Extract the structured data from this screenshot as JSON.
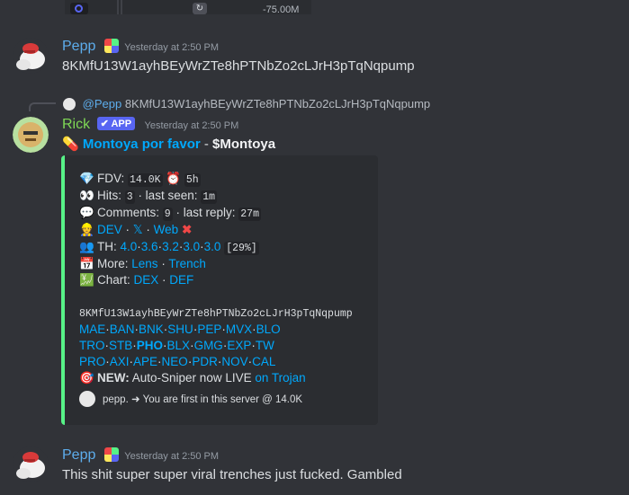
{
  "top_strip": {
    "value": "-75.00M"
  },
  "messages": [
    {
      "username": "Pepp",
      "timestamp": "Yesterday at 2:50 PM",
      "text": "8KMfU13W1ayhBEyWrZTe8hPTNbZo2cLJrH3pTqNqpump",
      "username_color": "#5dadec"
    },
    {
      "username": "Rick",
      "tag": "APP",
      "timestamp": "Yesterday at 2:50 PM",
      "username_color": "#7fd855",
      "reply": {
        "username": "@Pepp",
        "text": "8KMfU13W1ayhBEyWrZTe8hPTNbZo2cLJrH3pTqNqpump"
      },
      "headline": {
        "emoji": "pill",
        "title": "Montoya por favor",
        "sep": " - ",
        "ticker": "$Montoya"
      }
    },
    {
      "username": "Pepp",
      "timestamp": "Yesterday at 2:50 PM",
      "text": "This shit super super viral trenches just fucked. Gambled",
      "username_color": "#5dadec"
    }
  ],
  "embed": {
    "accent": "#57f287",
    "fdv_label": "FDV:",
    "fdv_value": "14.0K",
    "age_value": "5h",
    "hits_label": "Hits:",
    "hits_value": "3",
    "last_seen_label": "· last seen:",
    "last_seen_value": "1m",
    "comments_label": "Comments:",
    "comments_value": "9",
    "last_reply_label": "· last reply:",
    "last_reply_value": "27m",
    "dev_link": "DEV",
    "x_link": "𝕏",
    "web_link": "Web",
    "th_label": "TH:",
    "th_values": [
      "4.0",
      "3.6",
      "3.2",
      "3.0",
      "3.0"
    ],
    "th_total": "[29%]",
    "more_label": "More:",
    "more_links": [
      "Lens",
      "Trench"
    ],
    "chart_label": "Chart:",
    "chart_links": [
      "DEX",
      "DEF"
    ],
    "address": "8KMfU13W1ayhBEyWrZTe8hPTNbZo2cLJrH3pTqNqpump",
    "platform_rows": [
      [
        "MAE",
        "BAN",
        "BNK",
        "SHU",
        "PEP",
        "MVX",
        "BLO"
      ],
      [
        "TRO",
        "STB",
        "PHO",
        "BLX",
        "GMG",
        "EXP",
        "TW"
      ],
      [
        "PRO",
        "AXI",
        "APE",
        "NEO",
        "PDR",
        "NOV",
        "CAL"
      ]
    ],
    "new_label": "NEW:",
    "new_text": "Auto-Sniper now LIVE",
    "new_link": "on Trojan",
    "footer_text": "pepp. ➜ You are first in this server @ 14.0K"
  }
}
